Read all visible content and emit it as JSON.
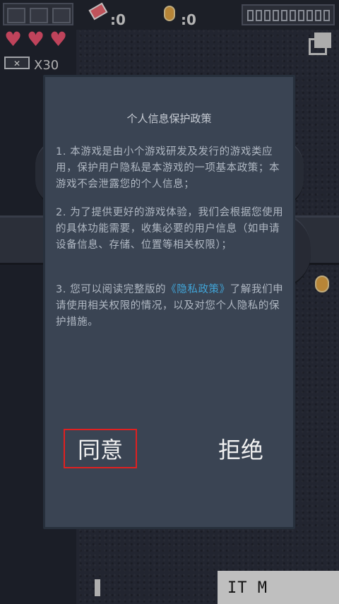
{
  "hud": {
    "gems": ":0",
    "coins": ":0",
    "multiplier": "X30",
    "heart_glyph": "♥",
    "battery_glyph": "✕",
    "score_digits": 10
  },
  "dialog": {
    "title": "个人信息保护政策",
    "para1": "1. 本游戏是由小个游戏研发及发行的游戏类应用，保护用户隐私是本游戏的一项基本政策；本游戏不会泄露您的个人信息；",
    "para2": "2. 为了提供更好的游戏体验，我们会根据您使用的具体功能需要，收集必要的用户信息（如申请设备信息、存储、位置等相关权限）；",
    "para3_before": "3. 您可以阅读完整版的",
    "para3_link": "《隐私政策》",
    "para3_after": "了解我们申请使用相关权限的情况，以及对您个人隐私的保护措施。",
    "agree": "同意",
    "reject": "拒绝"
  },
  "watermark": "IT  M",
  "colors": {
    "accent_link": "#41a5d8",
    "highlight_border": "#e02020",
    "heart": "#ff5a7a",
    "coin": "#f4b24a"
  }
}
